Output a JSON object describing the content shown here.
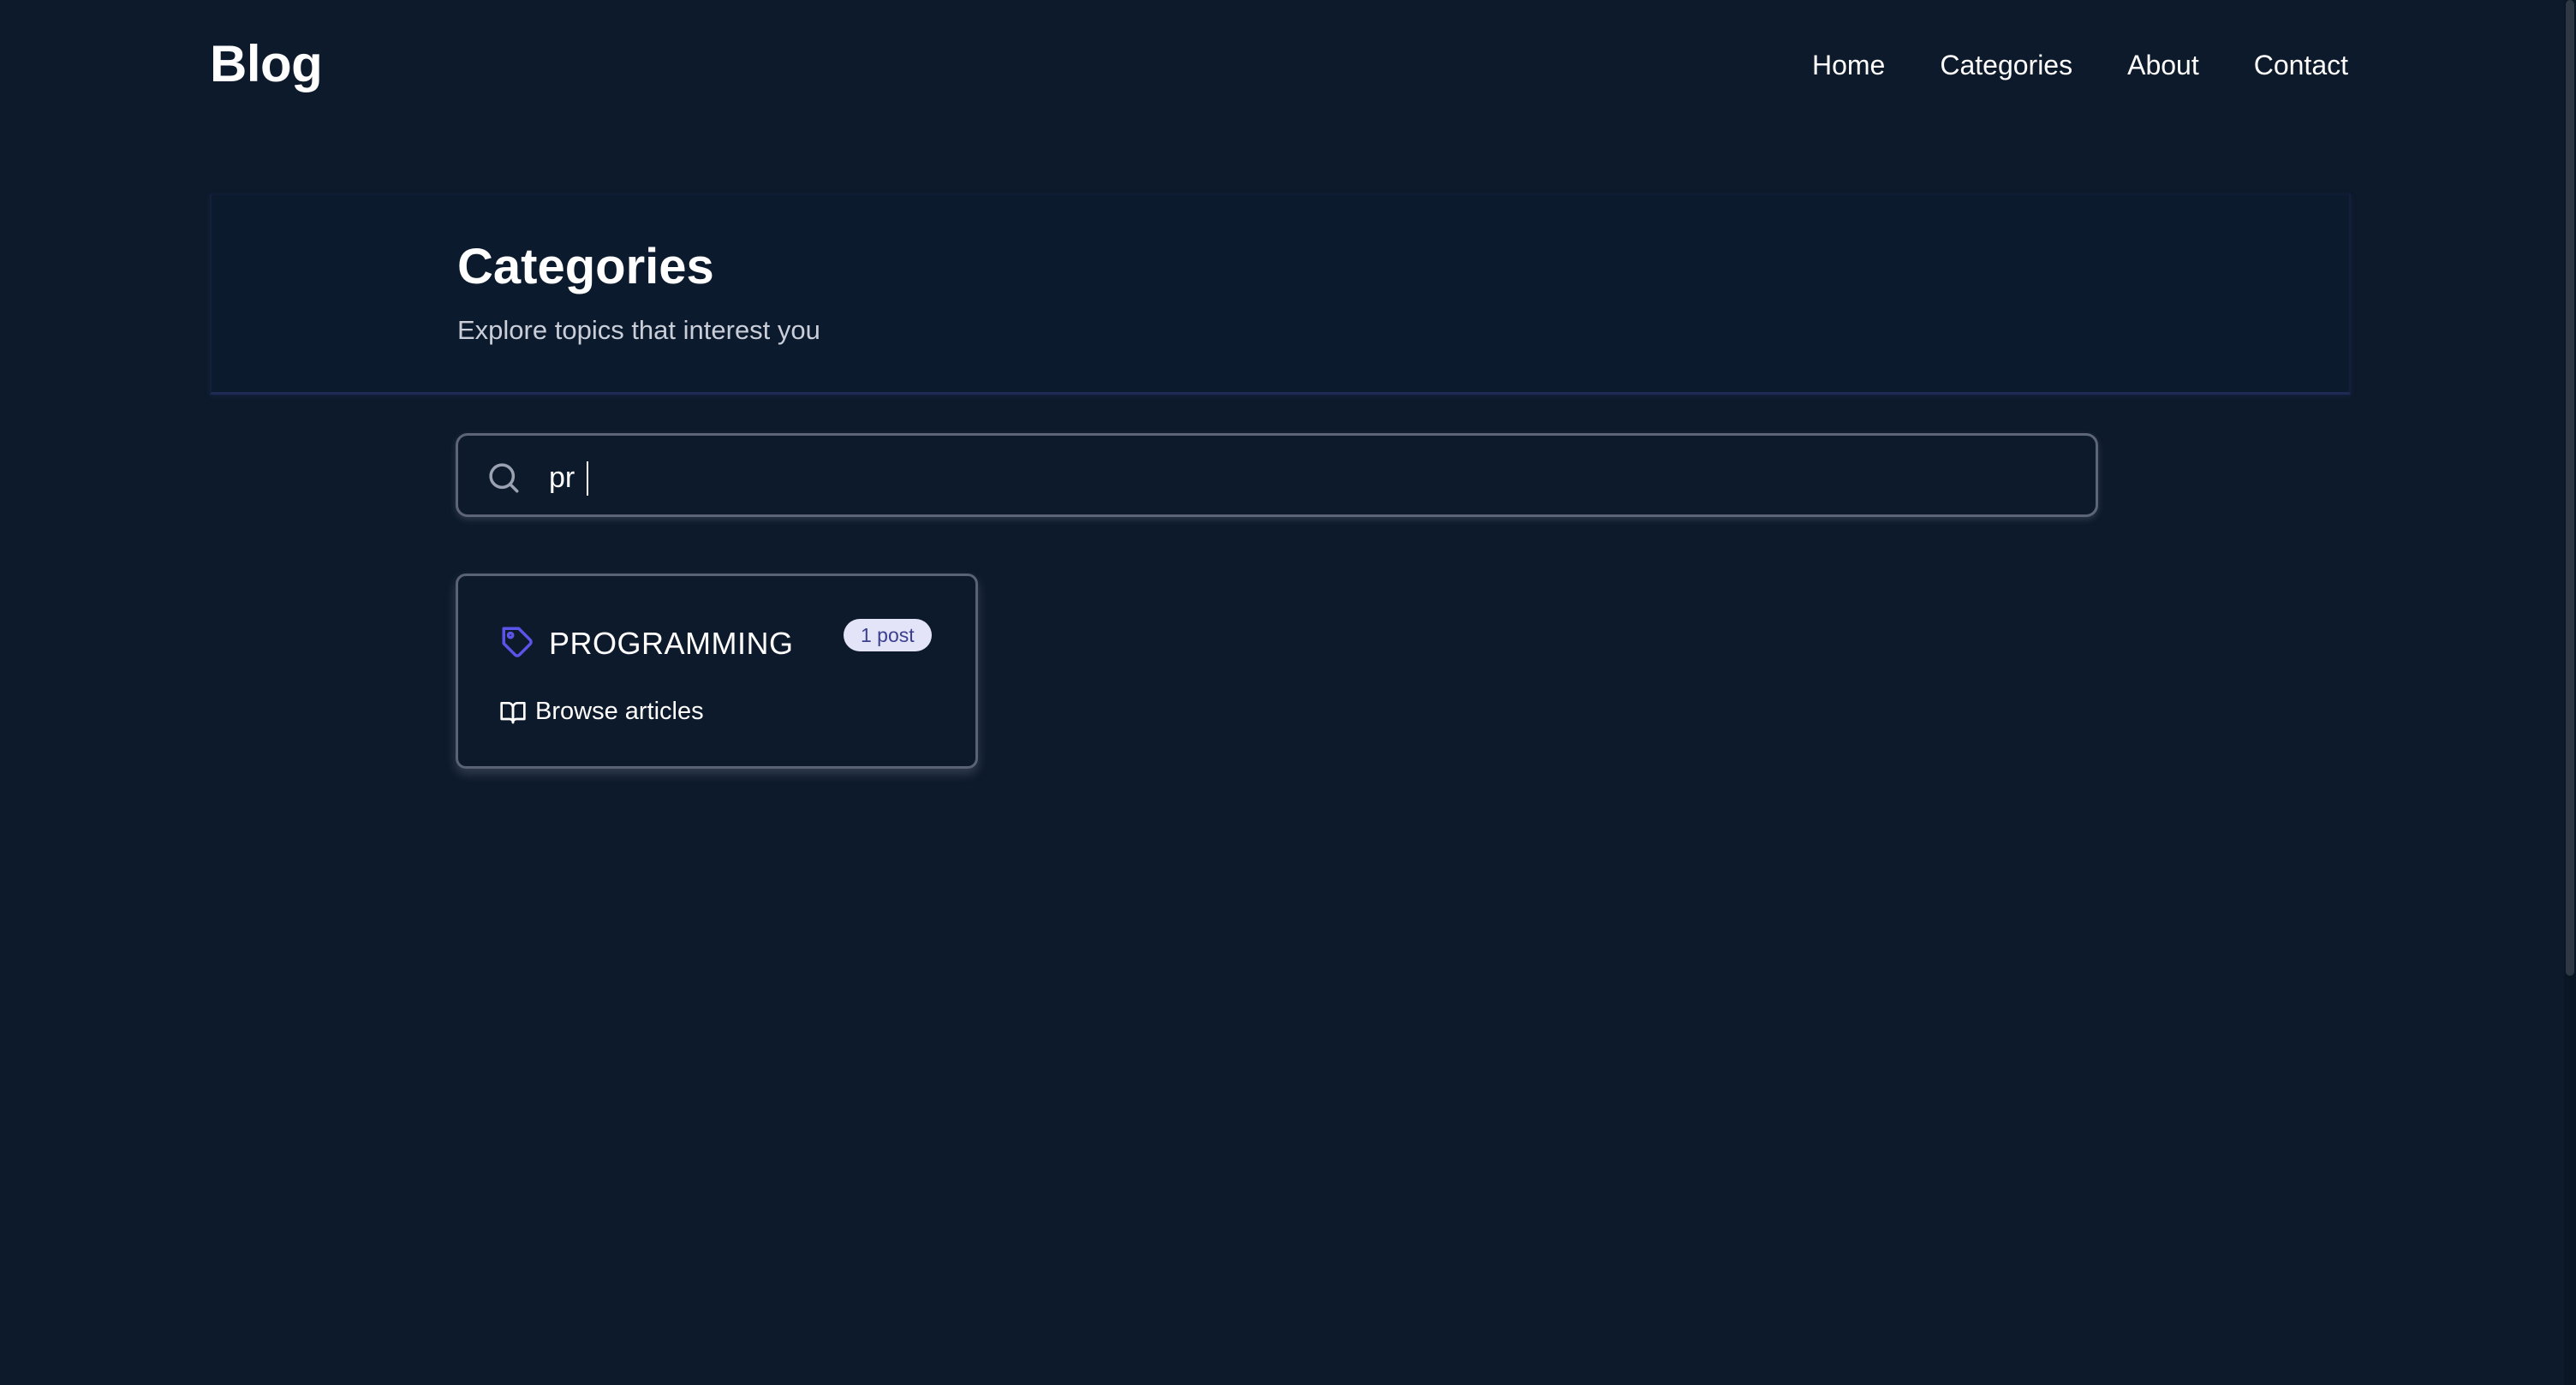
{
  "header": {
    "brand": "Blog",
    "nav": [
      {
        "label": "Home"
      },
      {
        "label": "Categories"
      },
      {
        "label": "About"
      },
      {
        "label": "Contact"
      }
    ]
  },
  "hero": {
    "title": "Categories",
    "subtitle": "Explore topics that interest you"
  },
  "search": {
    "value": "pr",
    "icon": "search-icon"
  },
  "categories": [
    {
      "name": "PROGRAMMING",
      "count_label": "1 post",
      "action_label": "Browse articles",
      "icon": "tag-icon",
      "action_icon": "book-open-icon"
    }
  ],
  "colors": {
    "background": "#0d1a2b",
    "accent": "#5b54e8",
    "badge_bg": "#e3e4f7",
    "badge_text": "#3a3f8f"
  }
}
